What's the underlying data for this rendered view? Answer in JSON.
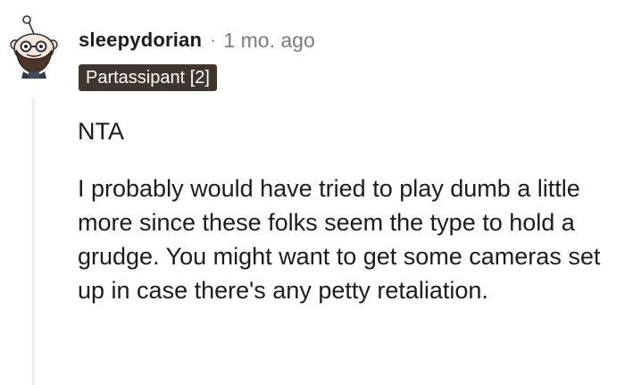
{
  "comment": {
    "username": "sleepydorian",
    "separator": "·",
    "timestamp": "1 mo. ago",
    "flair": "Partassipant [2]",
    "paragraphs": [
      "NTA",
      "I probably would have tried to play dumb a little more since these folks seem the type to hold a grudge. You might want to get some cameras set up in case there's any petty retaliation."
    ]
  },
  "colors": {
    "username": "#1c1c1c",
    "meta": "#7c7c7c",
    "flair_bg": "#403630",
    "flair_text": "#ffffff",
    "thread_line": "#ececec"
  },
  "icons": {
    "avatar": "snoo-avatar-icon"
  }
}
